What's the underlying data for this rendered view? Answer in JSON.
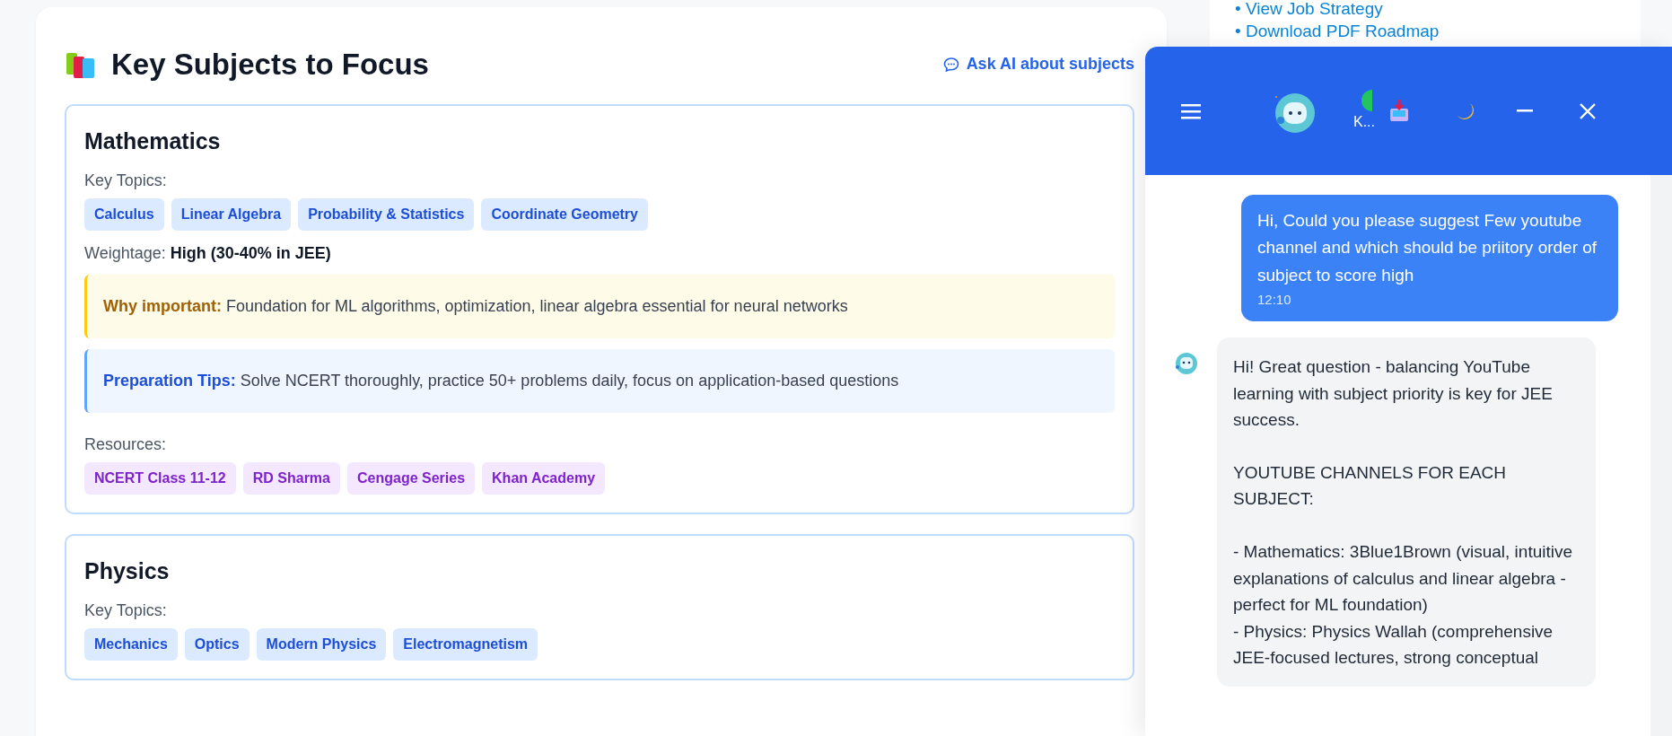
{
  "section": {
    "title": "Key Subjects to Focus",
    "ask_ai_link": "Ask AI about subjects"
  },
  "subjects": [
    {
      "name": "Mathematics",
      "topics_label": "Key Topics:",
      "topics": [
        "Calculus",
        "Linear Algebra",
        "Probability & Statistics",
        "Coordinate Geometry"
      ],
      "weightage_label": "Weightage:",
      "weightage": "High (30-40% in JEE)",
      "callouts": [
        {
          "kind": "importance",
          "label": "Why important:",
          "text": "Foundation for ML algorithms, optimization, linear algebra essential for neural networks"
        },
        {
          "kind": "tips",
          "label": "Preparation Tips:",
          "text": "Solve NCERT thoroughly, practice 50+ problems daily, focus on application-based questions"
        }
      ],
      "resources_label": "Resources:",
      "resources": [
        "NCERT Class 11-12",
        "RD Sharma",
        "Cengage Series",
        "Khan Academy"
      ]
    },
    {
      "name": "Physics",
      "topics_label": "Key Topics:",
      "topics": [
        "Mechanics",
        "Optics",
        "Modern Physics",
        "Electromagnetism"
      ]
    }
  ],
  "side_panel": {
    "links": [
      "• View Job Strategy",
      "• Download PDF Roadmap"
    ]
  },
  "chat": {
    "contact_name": "K...",
    "messages": [
      {
        "kind": "user",
        "text": "Hi, Could you please suggest Few youtube channel and which should be priitory order of subject to score high",
        "time": "12:10"
      },
      {
        "kind": "bot",
        "text": "Hi! Great question - balancing YouTube learning with subject priority is key for JEE success.\n\nYOUTUBE CHANNELS FOR EACH SUBJECT:\n\n- Mathematics: 3Blue1Brown (visual, intuitive explanations of calculus and linear algebra - perfect for ML foundation)\n- Physics: Physics Wallah (comprehensive JEE-focused lectures, strong conceptual"
      }
    ]
  }
}
